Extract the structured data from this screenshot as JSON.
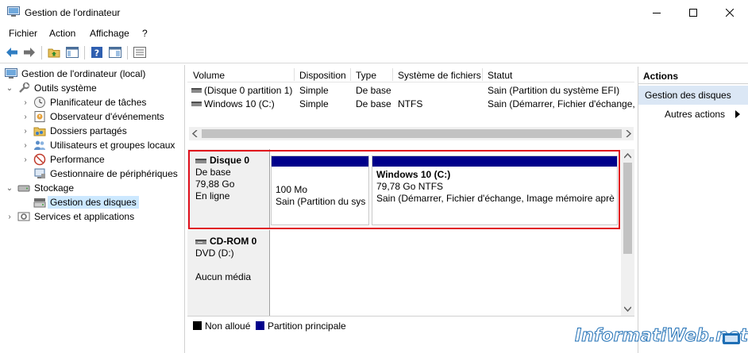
{
  "window": {
    "title": "Gestion de l'ordinateur"
  },
  "menu": [
    "Fichier",
    "Action",
    "Affichage",
    "?"
  ],
  "tree": {
    "root": "Gestion de l'ordinateur (local)",
    "outils": "Outils système",
    "planificateur": "Planificateur de tâches",
    "observateur": "Observateur d'événements",
    "dossiers": "Dossiers partagés",
    "utilisateurs": "Utilisateurs et groupes locaux",
    "performance": "Performance",
    "gestionnaire": "Gestionnaire de périphériques",
    "stockage": "Stockage",
    "gestion_disques": "Gestion des disques",
    "services": "Services et applications"
  },
  "volumes": {
    "headers": [
      "Volume",
      "Disposition",
      "Type",
      "Système de fichiers",
      "Statut"
    ],
    "rows": [
      [
        "(Disque 0 partition 1)",
        "Simple",
        "De base",
        "",
        "Sain (Partition du système EFI)"
      ],
      [
        "Windows 10 (C:)",
        "Simple",
        "De base",
        "NTFS",
        "Sain (Démarrer, Fichier d'échange,"
      ]
    ]
  },
  "disk0": {
    "name": "Disque 0",
    "type": "De base",
    "size": "79,88 Go",
    "status": "En ligne",
    "part1": {
      "size": "100 Mo",
      "status": "Sain (Partition du sys"
    },
    "part2": {
      "name": "Windows 10  (C:)",
      "size": "79,78 Go NTFS",
      "status": "Sain (Démarrer, Fichier d'échange, Image mémoire aprè"
    }
  },
  "cdrom": {
    "name": "CD-ROM 0",
    "type": "DVD (D:)",
    "status": "Aucun média"
  },
  "legend": {
    "unallocated": "Non alloué",
    "primary": "Partition principale",
    "unallocated_color": "#000000",
    "primary_color": "#00008b"
  },
  "actions": {
    "header": "Actions",
    "selected": "Gestion des disques",
    "more": "Autres actions"
  },
  "watermark": "InformatiWeb.net"
}
